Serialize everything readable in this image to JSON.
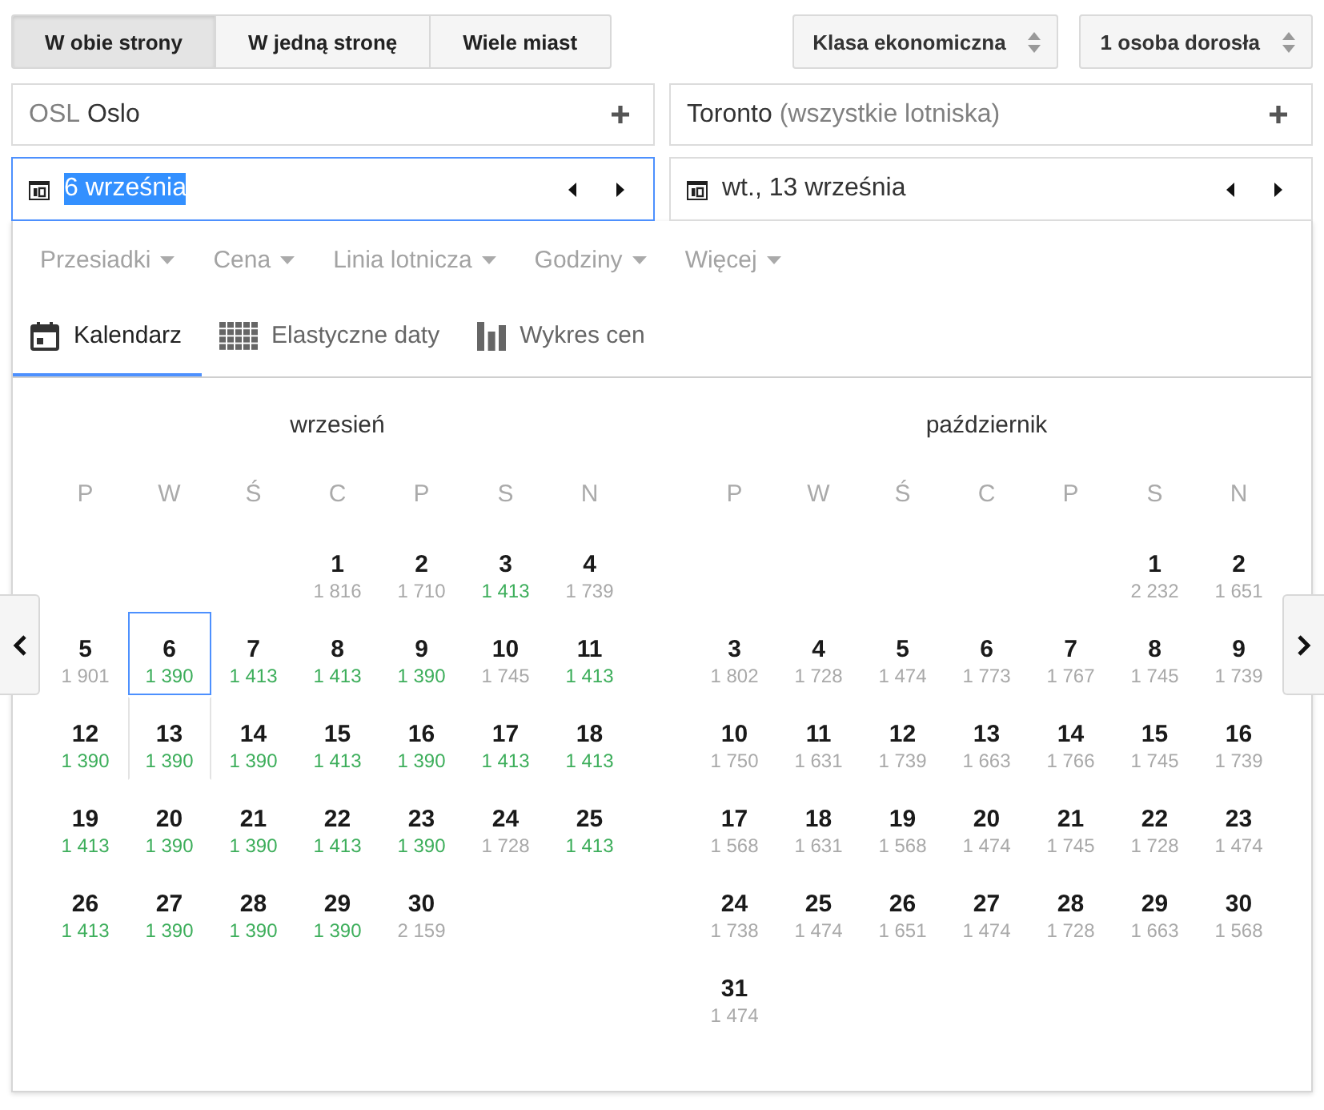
{
  "trip_types": [
    {
      "label": "W obie strony",
      "selected": true
    },
    {
      "label": "W jedną stronę",
      "selected": false
    },
    {
      "label": "Wiele miast",
      "selected": false
    }
  ],
  "selectors": [
    {
      "label": "Klasa ekonomiczna"
    },
    {
      "label": "1 osoba dorosła"
    }
  ],
  "origin": {
    "code": "OSL",
    "name": "Oslo"
  },
  "destination": {
    "name": "Toronto",
    "note": "(wszystkie lotniska)"
  },
  "dates": [
    {
      "value": "6 września",
      "focused": true
    },
    {
      "value": "wt., 13 września",
      "focused": false
    }
  ],
  "filters": [
    "Przesiadki",
    "Cena",
    "Linia lotnicza",
    "Godziny",
    "Więcej"
  ],
  "views": [
    {
      "label": "Kalendarz",
      "selected": true
    },
    {
      "label": "Elastyczne daty",
      "selected": false
    },
    {
      "label": "Wykres cen",
      "selected": false
    }
  ],
  "months": [
    {
      "title": "wrzesień",
      "weekdays": [
        "P",
        "W",
        "Ś",
        "C",
        "P",
        "S",
        "N"
      ],
      "weeks": [
        [
          {
            "day": "1",
            "price": "1 816",
            "cheap": false,
            "selected": false,
            "return": false
          },
          {
            "day": "2",
            "price": "1 710",
            "cheap": false,
            "selected": false,
            "return": false
          },
          {
            "day": "3",
            "price": "1 413",
            "cheap": true,
            "selected": false,
            "return": false
          },
          {
            "day": "4",
            "price": "1 739",
            "cheap": false,
            "selected": false,
            "return": false
          }
        ],
        [
          {
            "day": "5",
            "price": "1 901",
            "cheap": false,
            "selected": false,
            "return": false
          },
          {
            "day": "6",
            "price": "1 390",
            "cheap": true,
            "selected": true,
            "return": false
          },
          {
            "day": "7",
            "price": "1 413",
            "cheap": true,
            "selected": false,
            "return": false
          },
          {
            "day": "8",
            "price": "1 413",
            "cheap": true,
            "selected": false,
            "return": false
          },
          {
            "day": "9",
            "price": "1 390",
            "cheap": true,
            "selected": false,
            "return": false
          },
          {
            "day": "10",
            "price": "1 745",
            "cheap": false,
            "selected": false,
            "return": false
          },
          {
            "day": "11",
            "price": "1 413",
            "cheap": true,
            "selected": false,
            "return": false
          }
        ],
        [
          {
            "day": "12",
            "price": "1 390",
            "cheap": true,
            "selected": false,
            "return": false
          },
          {
            "day": "13",
            "price": "1 390",
            "cheap": true,
            "selected": false,
            "return": true
          },
          {
            "day": "14",
            "price": "1 390",
            "cheap": true,
            "selected": false,
            "return": false
          },
          {
            "day": "15",
            "price": "1 413",
            "cheap": true,
            "selected": false,
            "return": false
          },
          {
            "day": "16",
            "price": "1 390",
            "cheap": true,
            "selected": false,
            "return": false
          },
          {
            "day": "17",
            "price": "1 413",
            "cheap": true,
            "selected": false,
            "return": false
          },
          {
            "day": "18",
            "price": "1 413",
            "cheap": true,
            "selected": false,
            "return": false
          }
        ],
        [
          {
            "day": "19",
            "price": "1 413",
            "cheap": true,
            "selected": false,
            "return": false
          },
          {
            "day": "20",
            "price": "1 390",
            "cheap": true,
            "selected": false,
            "return": false
          },
          {
            "day": "21",
            "price": "1 390",
            "cheap": true,
            "selected": false,
            "return": false
          },
          {
            "day": "22",
            "price": "1 413",
            "cheap": true,
            "selected": false,
            "return": false
          },
          {
            "day": "23",
            "price": "1 390",
            "cheap": true,
            "selected": false,
            "return": false
          },
          {
            "day": "24",
            "price": "1 728",
            "cheap": false,
            "selected": false,
            "return": false
          },
          {
            "day": "25",
            "price": "1 413",
            "cheap": true,
            "selected": false,
            "return": false
          }
        ],
        [
          {
            "day": "26",
            "price": "1 413",
            "cheap": true,
            "selected": false,
            "return": false
          },
          {
            "day": "27",
            "price": "1 390",
            "cheap": true,
            "selected": false,
            "return": false
          },
          {
            "day": "28",
            "price": "1 390",
            "cheap": true,
            "selected": false,
            "return": false
          },
          {
            "day": "29",
            "price": "1 390",
            "cheap": true,
            "selected": false,
            "return": false
          },
          {
            "day": "30",
            "price": "2 159",
            "cheap": false,
            "selected": false,
            "return": false
          }
        ]
      ]
    },
    {
      "title": "październik",
      "weekdays": [
        "P",
        "W",
        "Ś",
        "C",
        "P",
        "S",
        "N"
      ],
      "weeks": [
        [
          {
            "day": "1",
            "price": "2 232",
            "cheap": false,
            "selected": false,
            "return": false
          },
          {
            "day": "2",
            "price": "1 651",
            "cheap": false,
            "selected": false,
            "return": false
          }
        ],
        [
          {
            "day": "3",
            "price": "1 802",
            "cheap": false,
            "selected": false,
            "return": false
          },
          {
            "day": "4",
            "price": "1 728",
            "cheap": false,
            "selected": false,
            "return": false
          },
          {
            "day": "5",
            "price": "1 474",
            "cheap": false,
            "selected": false,
            "return": false
          },
          {
            "day": "6",
            "price": "1 773",
            "cheap": false,
            "selected": false,
            "return": false
          },
          {
            "day": "7",
            "price": "1 767",
            "cheap": false,
            "selected": false,
            "return": false
          },
          {
            "day": "8",
            "price": "1 745",
            "cheap": false,
            "selected": false,
            "return": false
          },
          {
            "day": "9",
            "price": "1 739",
            "cheap": false,
            "selected": false,
            "return": false
          }
        ],
        [
          {
            "day": "10",
            "price": "1 750",
            "cheap": false,
            "selected": false,
            "return": false
          },
          {
            "day": "11",
            "price": "1 631",
            "cheap": false,
            "selected": false,
            "return": false
          },
          {
            "day": "12",
            "price": "1 739",
            "cheap": false,
            "selected": false,
            "return": false
          },
          {
            "day": "13",
            "price": "1 663",
            "cheap": false,
            "selected": false,
            "return": false
          },
          {
            "day": "14",
            "price": "1 766",
            "cheap": false,
            "selected": false,
            "return": false
          },
          {
            "day": "15",
            "price": "1 745",
            "cheap": false,
            "selected": false,
            "return": false
          },
          {
            "day": "16",
            "price": "1 739",
            "cheap": false,
            "selected": false,
            "return": false
          }
        ],
        [
          {
            "day": "17",
            "price": "1 568",
            "cheap": false,
            "selected": false,
            "return": false
          },
          {
            "day": "18",
            "price": "1 631",
            "cheap": false,
            "selected": false,
            "return": false
          },
          {
            "day": "19",
            "price": "1 568",
            "cheap": false,
            "selected": false,
            "return": false
          },
          {
            "day": "20",
            "price": "1 474",
            "cheap": false,
            "selected": false,
            "return": false
          },
          {
            "day": "21",
            "price": "1 745",
            "cheap": false,
            "selected": false,
            "return": false
          },
          {
            "day": "22",
            "price": "1 728",
            "cheap": false,
            "selected": false,
            "return": false
          },
          {
            "day": "23",
            "price": "1 474",
            "cheap": false,
            "selected": false,
            "return": false
          }
        ],
        [
          {
            "day": "24",
            "price": "1 738",
            "cheap": false,
            "selected": false,
            "return": false
          },
          {
            "day": "25",
            "price": "1 474",
            "cheap": false,
            "selected": false,
            "return": false
          },
          {
            "day": "26",
            "price": "1 651",
            "cheap": false,
            "selected": false,
            "return": false
          },
          {
            "day": "27",
            "price": "1 474",
            "cheap": false,
            "selected": false,
            "return": false
          },
          {
            "day": "28",
            "price": "1 728",
            "cheap": false,
            "selected": false,
            "return": false
          },
          {
            "day": "29",
            "price": "1 663",
            "cheap": false,
            "selected": false,
            "return": false
          },
          {
            "day": "30",
            "price": "1 568",
            "cheap": false,
            "selected": false,
            "return": false
          }
        ],
        [
          {
            "day": "31",
            "price": "1 474",
            "cheap": false,
            "selected": false,
            "return": false
          }
        ]
      ]
    }
  ]
}
